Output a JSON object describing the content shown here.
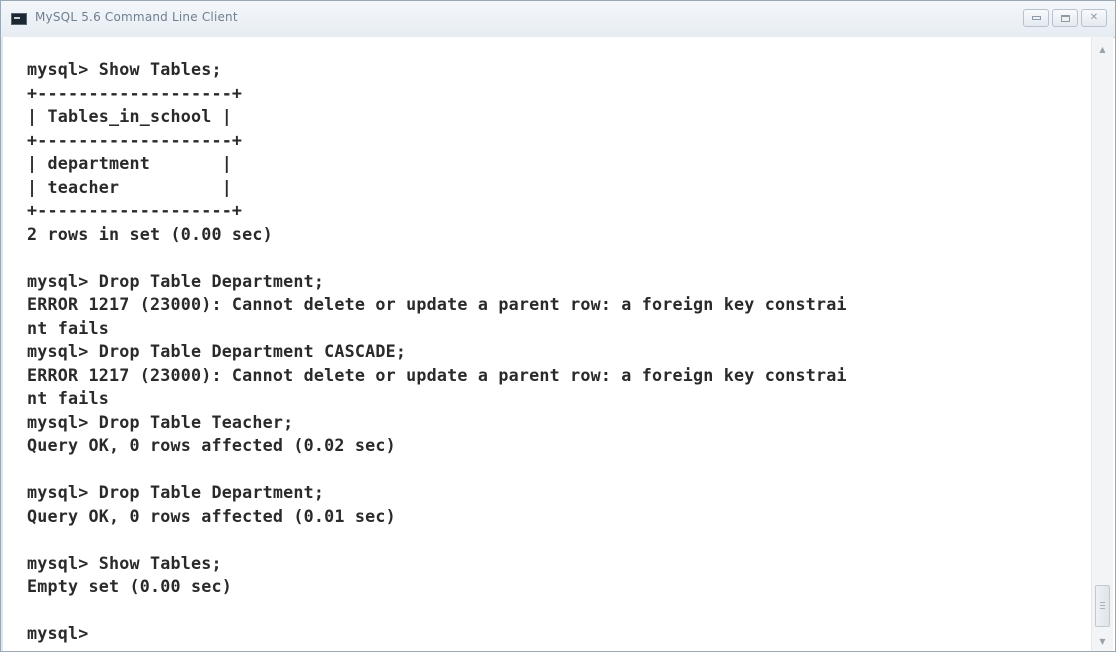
{
  "window": {
    "title": "MySQL 5.6 Command Line Client",
    "icon": "console-app-icon",
    "controls": {
      "minimize_icon": "minimize-icon",
      "maximize_icon": "maximize-icon",
      "close_glyph": "✕"
    }
  },
  "console": {
    "lines": [
      "mysql> Show Tables;",
      "+-------------------+",
      "| Tables_in_school |",
      "+-------------------+",
      "| department       |",
      "| teacher          |",
      "+-------------------+",
      "2 rows in set (0.00 sec)",
      "",
      "mysql> Drop Table Department;",
      "ERROR 1217 (23000): Cannot delete or update a parent row: a foreign key constrai",
      "nt fails",
      "mysql> Drop Table Department CASCADE;",
      "ERROR 1217 (23000): Cannot delete or update a parent row: a foreign key constrai",
      "nt fails",
      "mysql> Drop Table Teacher;",
      "Query OK, 0 rows affected (0.02 sec)",
      "",
      "mysql> Drop Table Department;",
      "Query OK, 0 rows affected (0.01 sec)",
      "",
      "mysql> Show Tables;",
      "Empty set (0.00 sec)",
      "",
      "mysql>"
    ]
  },
  "scrollbar": {
    "up_arrow": "▲",
    "down_arrow": "▼",
    "position": 1.0
  }
}
